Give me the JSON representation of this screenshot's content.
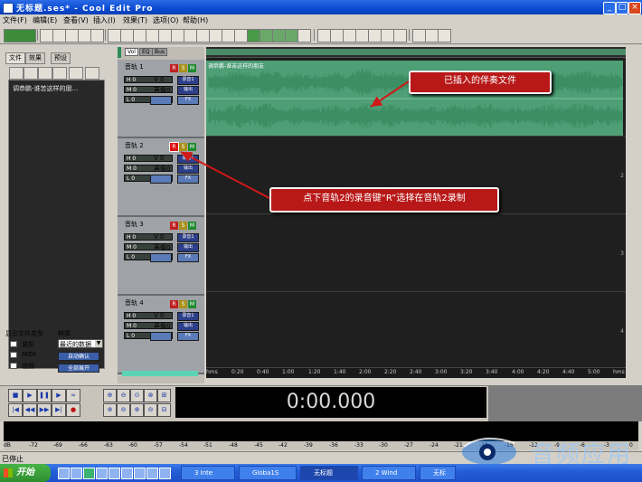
{
  "window": {
    "title": "无标题.ses* - Cool Edit Pro",
    "min": "_",
    "max": "□",
    "close": "×"
  },
  "menu": [
    "文件(F)",
    "编辑(E)",
    "查看(V)",
    "插入(I)",
    "效果(T)",
    "选项(O)",
    "帮助(H)"
  ],
  "left_panel": {
    "tabs": [
      "文件",
      "效果",
      "预设"
    ],
    "file_item": "调恭鹏-谁苦这样的朋...",
    "file_types_label": "显示文件类型",
    "sort_label": "种类",
    "sort_value": "最近的数据",
    "types": [
      "波形",
      "MIDI",
      "视频"
    ],
    "buttons": [
      "自动确认",
      "全部展开"
    ]
  },
  "track_panel_tabs": [
    "Vol",
    "EQ",
    "Bus"
  ],
  "tracks": [
    {
      "name": "音轨 1",
      "r": "R",
      "s": "S",
      "m": "M",
      "h": "H 0",
      "v": "V 0",
      "m0": "M 0",
      "pan": "声像0",
      "l": "L 0",
      "rec": "录音1",
      "out": "输出",
      "fx": "FX"
    },
    {
      "name": "音轨 2",
      "r": "R",
      "s": "S",
      "m": "M",
      "h": "H 0",
      "v": "V 0",
      "m0": "M 0",
      "pan": "声像0",
      "l": "L 0",
      "rec": "录音1",
      "out": "输出",
      "fx": "FX"
    },
    {
      "name": "音轨 3",
      "r": "R",
      "s": "S",
      "m": "M",
      "h": "H 0",
      "v": "V 0",
      "m0": "M 0",
      "pan": "声像0",
      "l": "L 0",
      "rec": "录音1",
      "out": "输出",
      "fx": "FX"
    },
    {
      "name": "音轨 4",
      "r": "R",
      "s": "S",
      "m": "M",
      "h": "H 0",
      "v": "V 0",
      "m0": "M 0",
      "pan": "声像0",
      "l": "L 0",
      "rec": "录音1",
      "out": "输出",
      "fx": "FX"
    }
  ],
  "lane_numbers": [
    "1",
    "2",
    "3",
    "4"
  ],
  "clip_label": "调恭鹏-谁苦这样的朋友",
  "timeline": [
    "hms",
    "0:20",
    "0:40",
    "1:00",
    "1:20",
    "1:40",
    "2:00",
    "2:20",
    "2:40",
    "3:00",
    "3:20",
    "3:40",
    "4:00",
    "4:20",
    "4:40",
    "5:00",
    "hms"
  ],
  "callouts": {
    "inserted": "已插入的伴奏文件",
    "record": "点下音轨2的录音键“R”选择在音轨2录制"
  },
  "time_display": "0:00.000",
  "level_ticks": [
    "dB",
    "-72",
    "-69",
    "-66",
    "-63",
    "-60",
    "-57",
    "-54",
    "-51",
    "-48",
    "-45",
    "-42",
    "-39",
    "-36",
    "-33",
    "-30",
    "-27",
    "-24",
    "-21",
    "-18",
    "-15",
    "-12",
    "-9",
    "-6",
    "-3",
    "0"
  ],
  "status": "已停止",
  "taskbar": {
    "start": "开始",
    "tasks": [
      "3 Inte",
      "Globa1S",
      "无标题",
      "2 Wind",
      "无标"
    ]
  },
  "watermark": "音频应用",
  "colors": {
    "waveform": "#3c8e63",
    "clip_bg": "#4e9e76",
    "callout": "#b81818",
    "track_bg": "#9fa2a6"
  },
  "icons": [
    "play-icon",
    "stop-icon",
    "pause-icon",
    "record-icon",
    "loop-icon",
    "rewind-icon",
    "fast-forward-icon",
    "zoom-in-icon",
    "zoom-out-icon"
  ]
}
